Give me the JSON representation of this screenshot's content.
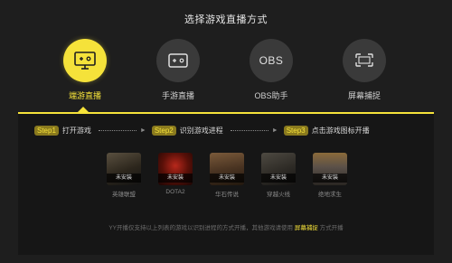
{
  "title": "选择游戏直播方式",
  "modes": [
    {
      "label": "端游直播",
      "icon": "monitor-icon",
      "active": true
    },
    {
      "label": "手游直播",
      "icon": "gamepad-screen-icon",
      "active": false
    },
    {
      "label": "OBS助手",
      "icon": "obs-text-icon",
      "active": false
    },
    {
      "label": "屏幕捕捉",
      "icon": "screen-capture-icon",
      "active": false
    }
  ],
  "obs_icon_text": "OBS",
  "steps": [
    {
      "badge": "Step1",
      "text": "打开游戏"
    },
    {
      "badge": "Step2",
      "text": "识别游戏进程"
    },
    {
      "badge": "Step3",
      "text": "点击游戏图标开播"
    }
  ],
  "arrow_glyph": "►",
  "games": [
    {
      "name": "英雄联盟",
      "status": "未安装"
    },
    {
      "name": "DOTA2",
      "status": "未安装"
    },
    {
      "name": "华石传说",
      "status": "未安装"
    },
    {
      "name": "穿越火线",
      "status": "未安装"
    },
    {
      "name": "绝地求生",
      "status": "未安装"
    }
  ],
  "tip": {
    "before": "YY开播仅支持以上列表的游戏以识别进程的方式开播，其他游戏请使用",
    "link": "屏幕捕捉",
    "after": "方式开播"
  },
  "colors": {
    "accent": "#f5e23a",
    "background": "#1e1e1e",
    "panel": "#161616"
  }
}
